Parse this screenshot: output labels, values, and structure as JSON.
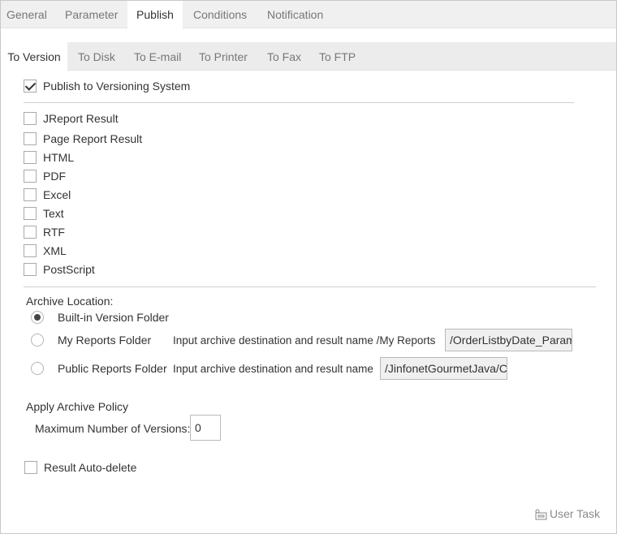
{
  "main_tabs": [
    {
      "label": "General"
    },
    {
      "label": "Parameter"
    },
    {
      "label": "Publish"
    },
    {
      "label": "Conditions"
    },
    {
      "label": "Notification"
    }
  ],
  "active_main_tab": "Publish",
  "sub_tabs": [
    {
      "label": "To Version"
    },
    {
      "label": "To Disk"
    },
    {
      "label": "To E-mail"
    },
    {
      "label": "To Printer"
    },
    {
      "label": "To Fax"
    },
    {
      "label": "To FTP"
    }
  ],
  "active_sub_tab": "To Version",
  "publish_checkbox": {
    "label": "Publish to Versioning System",
    "checked": true
  },
  "formats": [
    {
      "label": "JReport Result",
      "checked": false
    },
    {
      "label": "Page Report Result",
      "checked": false
    },
    {
      "label": "HTML",
      "checked": false
    },
    {
      "label": "PDF",
      "checked": false
    },
    {
      "label": "Excel",
      "checked": false
    },
    {
      "label": "Text",
      "checked": false
    },
    {
      "label": "RTF",
      "checked": false
    },
    {
      "label": "XML",
      "checked": false
    },
    {
      "label": "PostScript",
      "checked": false
    }
  ],
  "archive": {
    "title": "Archive Location:",
    "builtin_label": "Built-in Version Folder",
    "my_reports_label": "My Reports Folder",
    "my_reports_prompt": "Input archive destination and result name /My Reports",
    "my_reports_value": "/OrderListbyDate_Param",
    "public_label": "Public Reports Folder",
    "public_prompt": "Input archive destination and result name",
    "public_value": "/JinfonetGourmetJava/C",
    "selected": "builtin"
  },
  "policy": {
    "title": "Apply Archive Policy",
    "max_versions_label": "Maximum Number of Versions:",
    "max_versions_value": "0"
  },
  "auto_delete": {
    "label": "Result Auto-delete",
    "checked": false
  },
  "user_task": {
    "label": "User Task",
    "icon": "user-task-icon"
  }
}
